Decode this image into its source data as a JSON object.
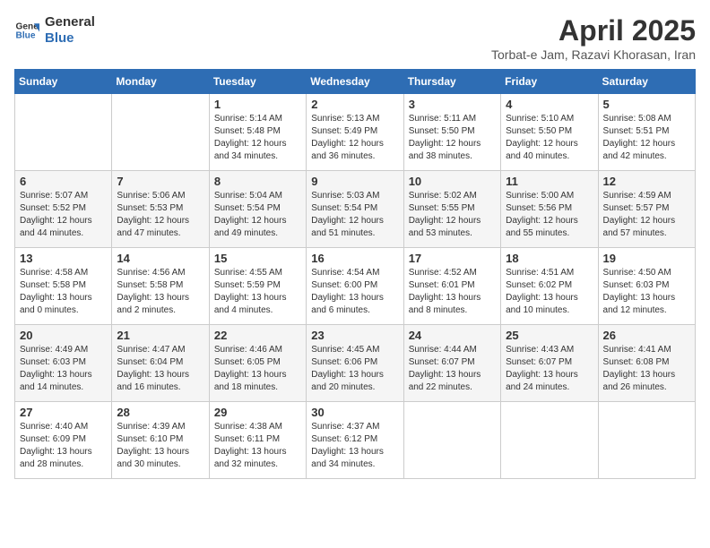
{
  "header": {
    "logo_line1": "General",
    "logo_line2": "Blue",
    "month_title": "April 2025",
    "subtitle": "Torbat-e Jam, Razavi Khorasan, Iran"
  },
  "weekdays": [
    "Sunday",
    "Monday",
    "Tuesday",
    "Wednesday",
    "Thursday",
    "Friday",
    "Saturday"
  ],
  "weeks": [
    [
      {
        "day": "",
        "info": ""
      },
      {
        "day": "",
        "info": ""
      },
      {
        "day": "1",
        "info": "Sunrise: 5:14 AM\nSunset: 5:48 PM\nDaylight: 12 hours\nand 34 minutes."
      },
      {
        "day": "2",
        "info": "Sunrise: 5:13 AM\nSunset: 5:49 PM\nDaylight: 12 hours\nand 36 minutes."
      },
      {
        "day": "3",
        "info": "Sunrise: 5:11 AM\nSunset: 5:50 PM\nDaylight: 12 hours\nand 38 minutes."
      },
      {
        "day": "4",
        "info": "Sunrise: 5:10 AM\nSunset: 5:50 PM\nDaylight: 12 hours\nand 40 minutes."
      },
      {
        "day": "5",
        "info": "Sunrise: 5:08 AM\nSunset: 5:51 PM\nDaylight: 12 hours\nand 42 minutes."
      }
    ],
    [
      {
        "day": "6",
        "info": "Sunrise: 5:07 AM\nSunset: 5:52 PM\nDaylight: 12 hours\nand 44 minutes."
      },
      {
        "day": "7",
        "info": "Sunrise: 5:06 AM\nSunset: 5:53 PM\nDaylight: 12 hours\nand 47 minutes."
      },
      {
        "day": "8",
        "info": "Sunrise: 5:04 AM\nSunset: 5:54 PM\nDaylight: 12 hours\nand 49 minutes."
      },
      {
        "day": "9",
        "info": "Sunrise: 5:03 AM\nSunset: 5:54 PM\nDaylight: 12 hours\nand 51 minutes."
      },
      {
        "day": "10",
        "info": "Sunrise: 5:02 AM\nSunset: 5:55 PM\nDaylight: 12 hours\nand 53 minutes."
      },
      {
        "day": "11",
        "info": "Sunrise: 5:00 AM\nSunset: 5:56 PM\nDaylight: 12 hours\nand 55 minutes."
      },
      {
        "day": "12",
        "info": "Sunrise: 4:59 AM\nSunset: 5:57 PM\nDaylight: 12 hours\nand 57 minutes."
      }
    ],
    [
      {
        "day": "13",
        "info": "Sunrise: 4:58 AM\nSunset: 5:58 PM\nDaylight: 13 hours\nand 0 minutes."
      },
      {
        "day": "14",
        "info": "Sunrise: 4:56 AM\nSunset: 5:58 PM\nDaylight: 13 hours\nand 2 minutes."
      },
      {
        "day": "15",
        "info": "Sunrise: 4:55 AM\nSunset: 5:59 PM\nDaylight: 13 hours\nand 4 minutes."
      },
      {
        "day": "16",
        "info": "Sunrise: 4:54 AM\nSunset: 6:00 PM\nDaylight: 13 hours\nand 6 minutes."
      },
      {
        "day": "17",
        "info": "Sunrise: 4:52 AM\nSunset: 6:01 PM\nDaylight: 13 hours\nand 8 minutes."
      },
      {
        "day": "18",
        "info": "Sunrise: 4:51 AM\nSunset: 6:02 PM\nDaylight: 13 hours\nand 10 minutes."
      },
      {
        "day": "19",
        "info": "Sunrise: 4:50 AM\nSunset: 6:03 PM\nDaylight: 13 hours\nand 12 minutes."
      }
    ],
    [
      {
        "day": "20",
        "info": "Sunrise: 4:49 AM\nSunset: 6:03 PM\nDaylight: 13 hours\nand 14 minutes."
      },
      {
        "day": "21",
        "info": "Sunrise: 4:47 AM\nSunset: 6:04 PM\nDaylight: 13 hours\nand 16 minutes."
      },
      {
        "day": "22",
        "info": "Sunrise: 4:46 AM\nSunset: 6:05 PM\nDaylight: 13 hours\nand 18 minutes."
      },
      {
        "day": "23",
        "info": "Sunrise: 4:45 AM\nSunset: 6:06 PM\nDaylight: 13 hours\nand 20 minutes."
      },
      {
        "day": "24",
        "info": "Sunrise: 4:44 AM\nSunset: 6:07 PM\nDaylight: 13 hours\nand 22 minutes."
      },
      {
        "day": "25",
        "info": "Sunrise: 4:43 AM\nSunset: 6:07 PM\nDaylight: 13 hours\nand 24 minutes."
      },
      {
        "day": "26",
        "info": "Sunrise: 4:41 AM\nSunset: 6:08 PM\nDaylight: 13 hours\nand 26 minutes."
      }
    ],
    [
      {
        "day": "27",
        "info": "Sunrise: 4:40 AM\nSunset: 6:09 PM\nDaylight: 13 hours\nand 28 minutes."
      },
      {
        "day": "28",
        "info": "Sunrise: 4:39 AM\nSunset: 6:10 PM\nDaylight: 13 hours\nand 30 minutes."
      },
      {
        "day": "29",
        "info": "Sunrise: 4:38 AM\nSunset: 6:11 PM\nDaylight: 13 hours\nand 32 minutes."
      },
      {
        "day": "30",
        "info": "Sunrise: 4:37 AM\nSunset: 6:12 PM\nDaylight: 13 hours\nand 34 minutes."
      },
      {
        "day": "",
        "info": ""
      },
      {
        "day": "",
        "info": ""
      },
      {
        "day": "",
        "info": ""
      }
    ]
  ]
}
